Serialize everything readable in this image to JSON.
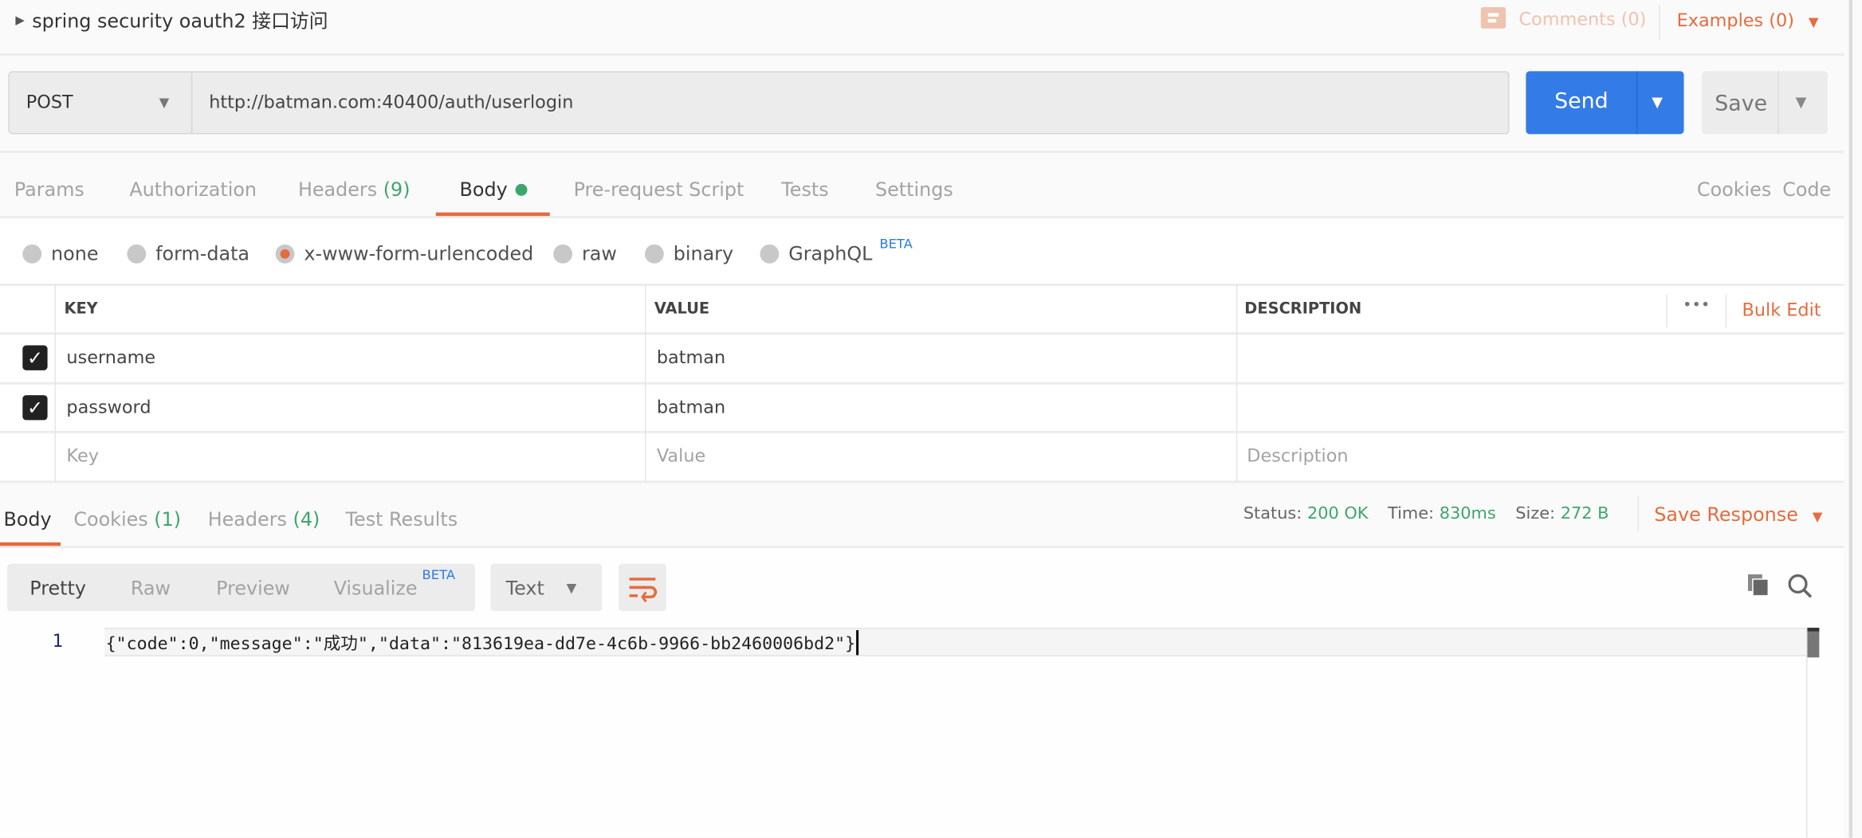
{
  "header": {
    "title": "spring security oauth2 接口访问",
    "comments_label": "Comments (0)",
    "examples_label": "Examples (0)"
  },
  "request": {
    "method": "POST",
    "url": "http://batman.com:40400/auth/userlogin",
    "send_label": "Send",
    "save_label": "Save"
  },
  "request_tabs": [
    {
      "label": "Params"
    },
    {
      "label": "Authorization"
    },
    {
      "label": "Headers",
      "count": "(9)"
    },
    {
      "label": "Body",
      "active": true
    },
    {
      "label": "Pre-request Script"
    },
    {
      "label": "Tests"
    },
    {
      "label": "Settings"
    }
  ],
  "request_links": {
    "cookies": "Cookies",
    "code": "Code"
  },
  "body_types": [
    {
      "label": "none"
    },
    {
      "label": "form-data"
    },
    {
      "label": "x-www-form-urlencoded",
      "selected": true
    },
    {
      "label": "raw"
    },
    {
      "label": "binary"
    },
    {
      "label": "GraphQL",
      "badge": "BETA"
    }
  ],
  "params_table": {
    "headers": {
      "key": "KEY",
      "value": "VALUE",
      "description": "DESCRIPTION",
      "bulk_edit": "Bulk Edit",
      "more": "•••"
    },
    "rows": [
      {
        "checked": true,
        "key": "username",
        "value": "batman",
        "description": ""
      },
      {
        "checked": true,
        "key": "password",
        "value": "batman",
        "description": ""
      }
    ],
    "placeholders": {
      "key": "Key",
      "value": "Value",
      "description": "Description"
    }
  },
  "response_tabs": [
    {
      "label": "Body",
      "active": true
    },
    {
      "label": "Cookies",
      "count": "(1)"
    },
    {
      "label": "Headers",
      "count": "(4)"
    },
    {
      "label": "Test Results"
    }
  ],
  "response_meta": {
    "status_label": "Status:",
    "status": "200 OK",
    "time_label": "Time:",
    "time": "830ms",
    "size_label": "Size:",
    "size": "272 B",
    "save_response": "Save Response"
  },
  "view_modes": [
    {
      "label": "Pretty",
      "active": true
    },
    {
      "label": "Raw"
    },
    {
      "label": "Preview"
    },
    {
      "label": "Visualize",
      "badge": "BETA"
    }
  ],
  "format": "Text",
  "code": {
    "line_number": "1",
    "line": "{\"code\":0,\"message\":\"成功\",\"data\":\"813619ea-dd7e-4c6b-9966-bb2460006bd2\"}"
  },
  "colors": {
    "accent": "#e46c3f",
    "send": "#337be6",
    "success": "#3ea66c"
  }
}
